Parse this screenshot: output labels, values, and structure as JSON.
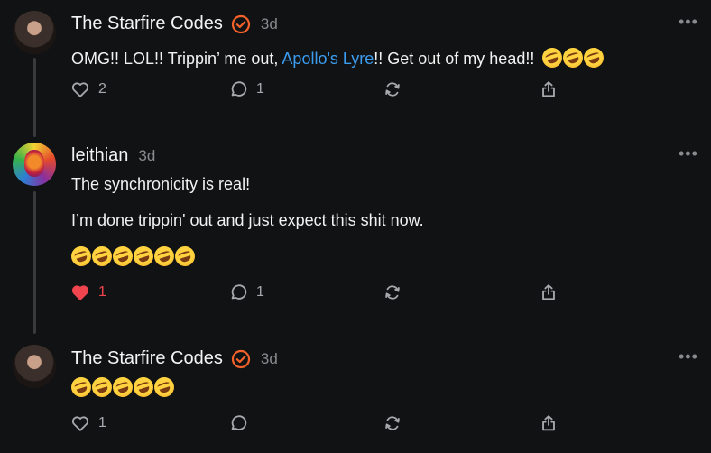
{
  "posts": [
    {
      "username": "The Starfire Codes",
      "verified": true,
      "time": "3d",
      "text_before": "OMG!! LOL!! Trippin’ me out, ",
      "link": "Apollo's Lyre",
      "text_after": "!! Get out of my head!!",
      "emoji_icon": "rolling-on-floor-laughing",
      "emoji_count_inline": 3,
      "likes": "2",
      "liked": false,
      "replies": "1"
    },
    {
      "username": "leithian",
      "verified": false,
      "time": "3d",
      "paragraphs": [
        "The synchronicity is real!",
        "I’m done trippin' out and just expect this shit now."
      ],
      "emoji_icon": "rolling-on-floor-laughing",
      "emoji_count": 6,
      "likes": "1",
      "liked": true,
      "replies": "1"
    },
    {
      "username": "The Starfire Codes",
      "verified": true,
      "time": "3d",
      "emoji_icon": "rolling-on-floor-laughing",
      "emoji_count": 5,
      "likes": "1",
      "liked": false,
      "replies": ""
    }
  ],
  "more_glyph": "•••",
  "colors": {
    "background": "#111213",
    "link": "#3b9cf0",
    "verified": "#f2622a",
    "liked": "#f0444e",
    "muted": "#8a8a8e"
  }
}
